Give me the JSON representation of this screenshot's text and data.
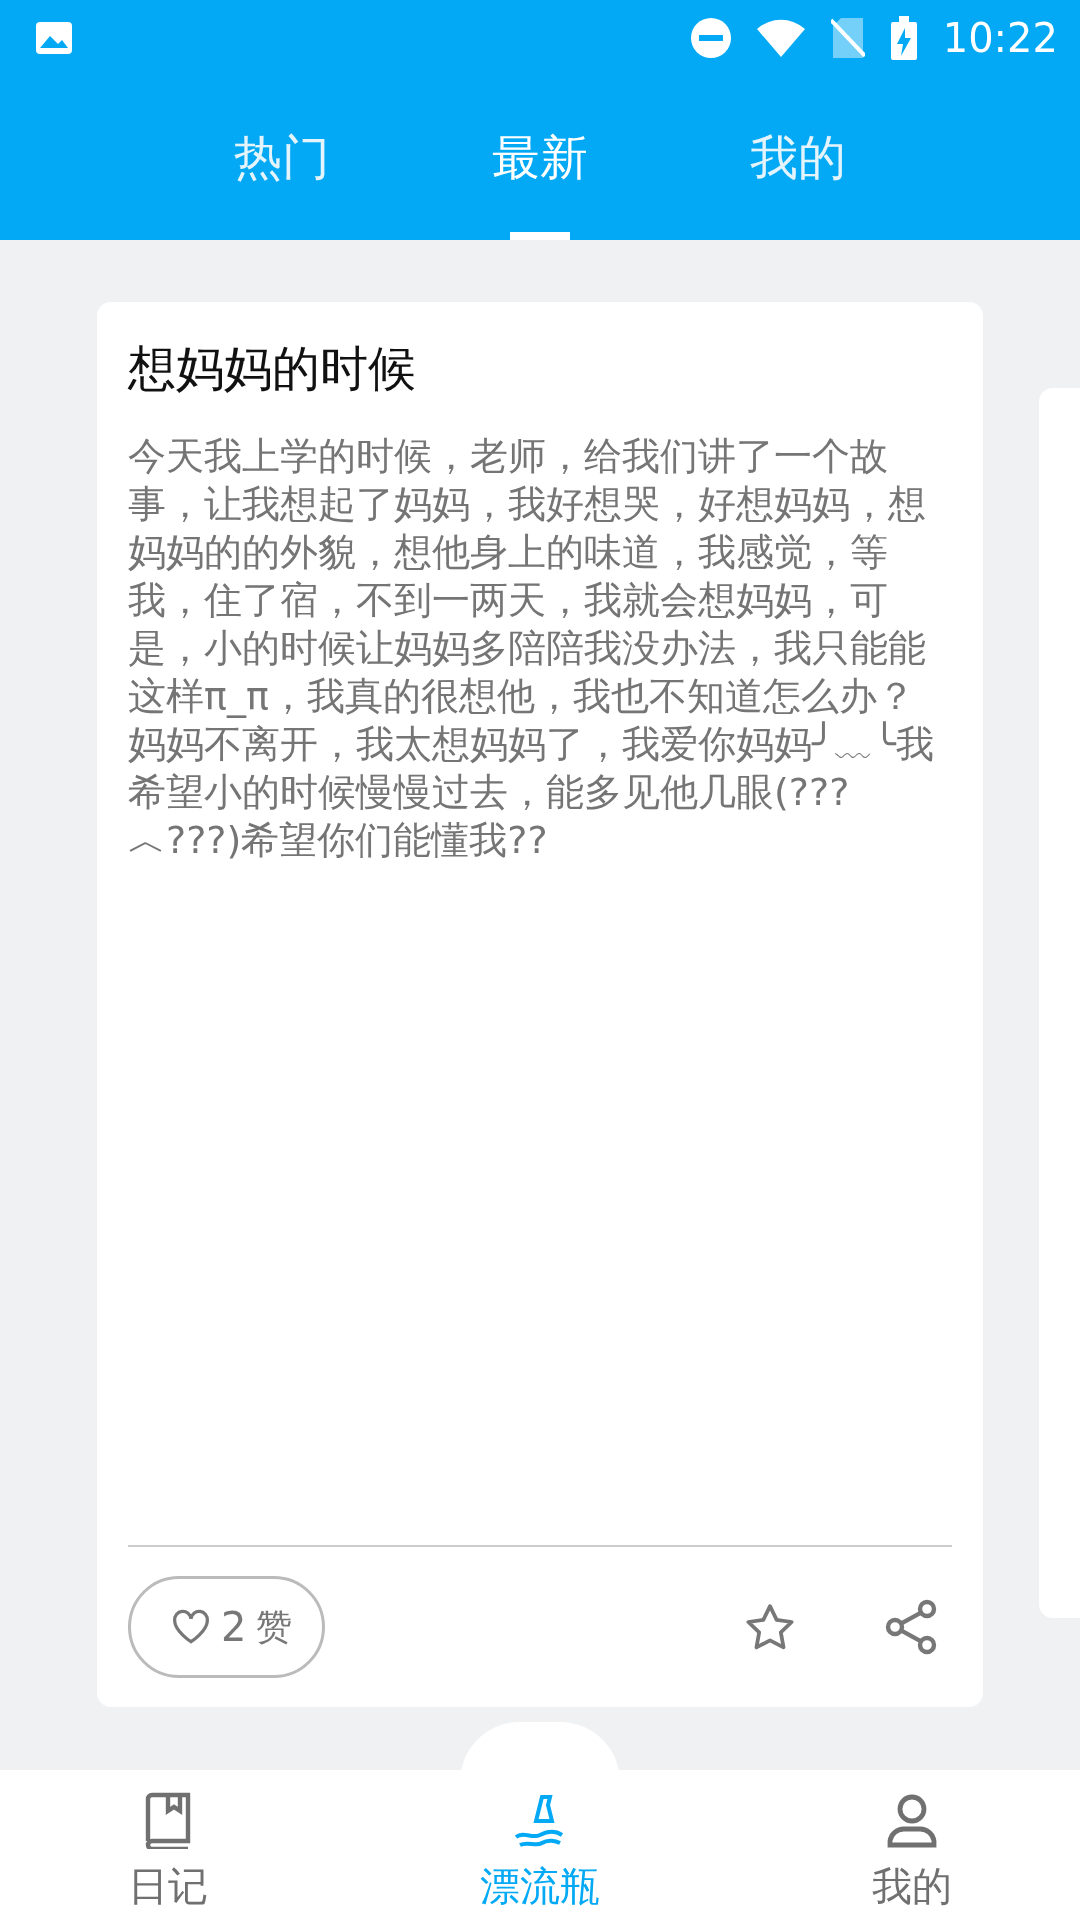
{
  "status_bar": {
    "time": "10:22"
  },
  "tabs": [
    {
      "label": "热门",
      "selected": false
    },
    {
      "label": "最新",
      "selected": true
    },
    {
      "label": "我的",
      "selected": false
    }
  ],
  "card": {
    "title": "想妈妈的时候",
    "body": "今天我上学的时候，老师，给我们讲了一个故事，让我想起了妈妈，我好想哭，好想妈妈，想妈妈的的外貌，想他身上的味道，我感觉，等我，住了宿，不到一两天，我就会想妈妈，可是，小的时候让妈妈多陪陪我没办法，我只能能这样π_π，我真的很想他，我也不知道怎么办？妈妈不离开，我太想妈妈了，我爱你妈妈╯﹏╰我希望小的时候慢慢过去，能多见他几眼(???︿???)希望你们能懂我??",
    "like_count": "2",
    "like_label": "赞"
  },
  "bottom_nav": [
    {
      "label": "日记",
      "kind": "diary",
      "selected": false
    },
    {
      "label": "漂流瓶",
      "kind": "bottle",
      "selected": true
    },
    {
      "label": "我的",
      "kind": "profile",
      "selected": false
    }
  ]
}
